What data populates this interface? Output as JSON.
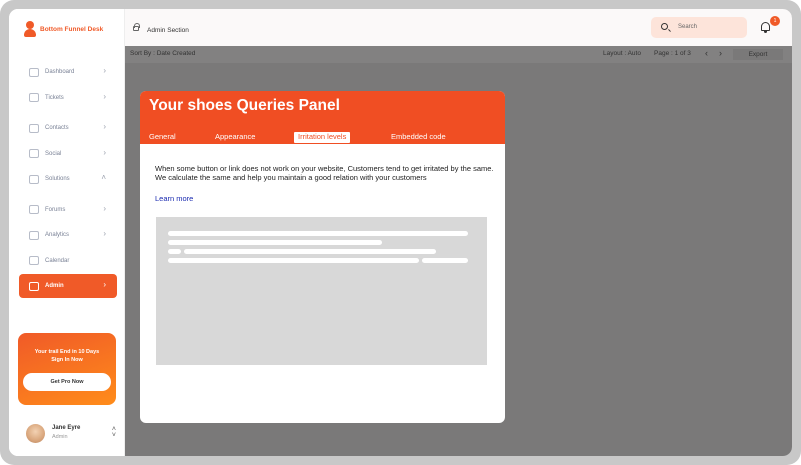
{
  "brand": {
    "name": "Bottom Funnel Desk",
    "icon": "user-icon"
  },
  "sidebar": {
    "items": [
      {
        "label": "Dashboard",
        "icon": "dashboard-icon"
      },
      {
        "label": "Tickets",
        "icon": "ticket-icon"
      },
      {
        "label": "Contacts",
        "icon": "contacts-icon"
      },
      {
        "label": "Social",
        "icon": "social-icon"
      },
      {
        "label": "Solutions",
        "icon": "solutions-icon"
      },
      {
        "label": "Forums",
        "icon": "forums-icon"
      },
      {
        "label": "Analytics",
        "icon": "analytics-icon"
      },
      {
        "label": "Calendar",
        "icon": "calendar-icon"
      },
      {
        "label": "Admin",
        "icon": "lock-icon",
        "active": true
      }
    ]
  },
  "promo": {
    "line1": "Your trail End in 10 Days",
    "line2": "Sign In Now",
    "button": "Get Pro Now"
  },
  "user": {
    "name": "Jane Eyre",
    "role": "Admin"
  },
  "header": {
    "section": "Admin Section",
    "search_placeholder": "Search",
    "notifications_count": "1"
  },
  "toolbar": {
    "sort": "Sort By : Date Created",
    "layout": "Layout : Auto",
    "page": "Page : 1 of 3",
    "export": "Export"
  },
  "panel": {
    "title": "Your shoes Queries Panel",
    "tabs": [
      "General",
      "Appearance",
      "Irritation levels",
      "Embedded code"
    ],
    "active_tab": "Irritation levels",
    "description_line1": "When some button or link does not work on your website, Customers tend to get irritated by the same.",
    "description_line2": "We calculate the same and help you maintain a good relation with your customers",
    "learn_more": "Learn more"
  },
  "colors": {
    "accent": "#f04e23",
    "overlay": "#7a7979",
    "link": "#1a2ab0"
  }
}
